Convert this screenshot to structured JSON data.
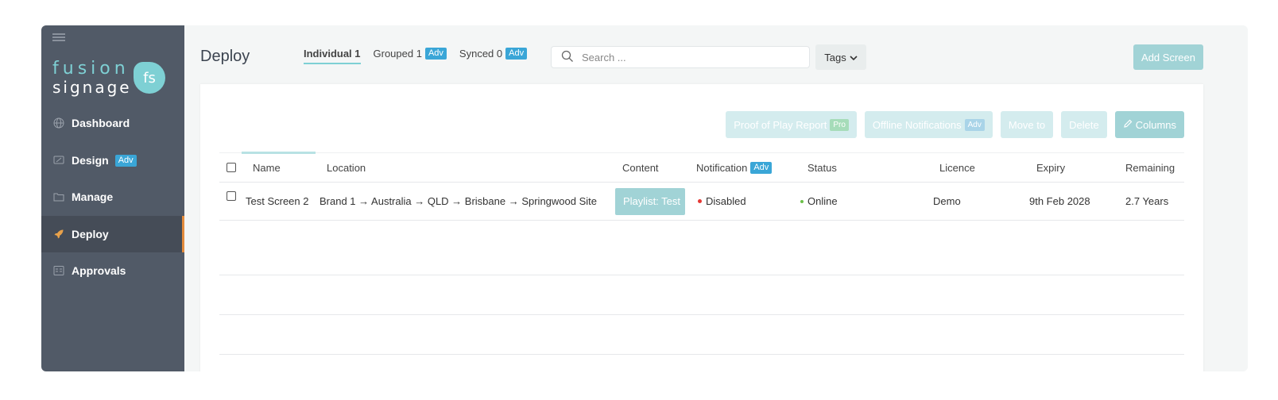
{
  "sidebar": {
    "logo_line1": "fusion",
    "logo_line2": "signage",
    "logo_mark": "fs",
    "items": [
      {
        "label": "Dashboard",
        "icon": "globe-icon"
      },
      {
        "label": "Design",
        "icon": "design-icon",
        "badge": "Adv"
      },
      {
        "label": "Manage",
        "icon": "folder-icon"
      },
      {
        "label": "Deploy",
        "icon": "rocket-icon",
        "active": true
      },
      {
        "label": "Approvals",
        "icon": "approvals-icon"
      }
    ]
  },
  "header": {
    "title": "Deploy",
    "tabs": [
      {
        "label": "Individual 1",
        "active": true
      },
      {
        "label": "Grouped 1",
        "badge": "Adv"
      },
      {
        "label": "Synced 0",
        "badge": "Adv"
      }
    ],
    "search_placeholder": "Search ...",
    "tags_label": "Tags",
    "add_screen_label": "Add Screen"
  },
  "actions": {
    "proof_of_play": "Proof of Play Report",
    "proof_badge": "Pro",
    "offline_notifications": "Offline Notifications",
    "offline_badge": "Adv",
    "move_to": "Move to",
    "delete": "Delete",
    "columns": "Columns"
  },
  "table": {
    "headers": {
      "name": "Name",
      "location": "Location",
      "content": "Content",
      "notification": "Notification",
      "notification_badge": "Adv",
      "status": "Status",
      "licence": "Licence",
      "expiry": "Expiry",
      "remaining": "Remaining"
    },
    "rows": [
      {
        "name": "Test Screen 2",
        "location": "Brand 1 → Australia → QLD → Brisbane → Springwood Site",
        "content": "Playlist: Test",
        "notification": "Disabled",
        "status": "Online",
        "licence": "Demo",
        "expiry": "9th Feb 2028",
        "remaining": "2.7 Years"
      }
    ]
  },
  "colors": {
    "accent": "#7ed0d4",
    "sidebar_bg": "#515a67",
    "status_online": "#6cc04a",
    "status_disabled": "#e53935",
    "active_indicator": "#e38b3c"
  }
}
